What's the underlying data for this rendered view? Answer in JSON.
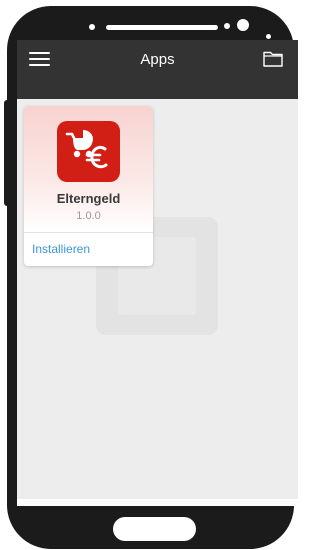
{
  "appbar": {
    "title": "Apps",
    "menu_icon": "hamburger-menu-icon",
    "folder_icon": "folder-icon"
  },
  "app_card": {
    "name": "Elterngeld",
    "version": "1.0.0",
    "install_label": "Installieren",
    "icon": "stroller-euro-icon"
  },
  "colors": {
    "appbar_background": "#333333",
    "screen_background": "#ededed",
    "app_icon_background": "#d21f16",
    "link": "#3b97d9",
    "device_frame": "#1b1b1b"
  }
}
